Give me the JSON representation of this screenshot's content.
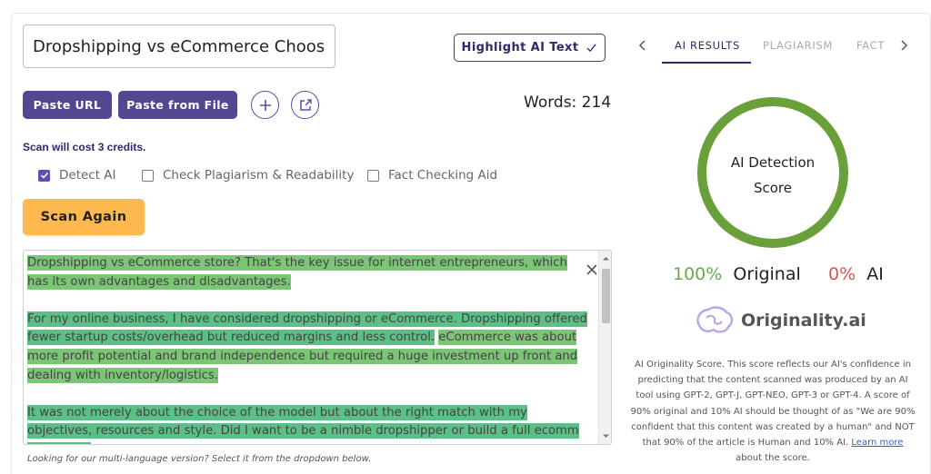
{
  "header": {
    "title_value": "Dropshipping vs eCommerce Choosing",
    "highlight_button": "Highlight AI Text"
  },
  "toolbar": {
    "paste_url": "Paste URL",
    "paste_file": "Paste from File",
    "words_label": "Words: 214"
  },
  "scan": {
    "cost_text": "Scan will cost 3 credits.",
    "options": [
      {
        "label": "Detect AI",
        "checked": true
      },
      {
        "label": "Check Plagiarism & Readability",
        "checked": false
      },
      {
        "label": "Fact Checking Aid",
        "checked": false
      }
    ],
    "scan_button": "Scan Again"
  },
  "editor": {
    "p1": "Dropshipping vs eCommerce store? That's the key issue for internet entrepreneurs, which has its own advantages and disadvantages.",
    "p2a": "For my online business, I have considered dropshipping or eCommerce. Dropshipping offered fewer startup costs/overhead but reduced margins and less control.",
    "p2b": "eCommerce was about more profit potential and brand independence but required a huge investment up front and dealing with inventory/logistics.",
    "p3a": "It was not merely about the choice of the model but about the right match with my objectives, resources and style. Did I want to be a nimble dropshipper or build a full ecomm operation?"
  },
  "footer_note": "Looking for our multi-language version? Select it from the dropdown below.",
  "results": {
    "tabs": [
      "AI RESULTS",
      "PLAGIARISM",
      "FACT"
    ],
    "active_tab": 0,
    "gauge_line1": "AI Detection",
    "gauge_line2": "Score",
    "original_pct": "100%",
    "original_label": "Original",
    "ai_pct": "0%",
    "ai_label": "AI",
    "logo_text": "Originality.ai",
    "description": "AI Originality Score. This score reflects our AI's confidence in predicting that the content scanned was produced by an AI tool using GPT-2, GPT-J, GPT-NEO, GPT-3 or GPT-4. A score of 90% original and 10% AI should be thought of as \"We are 90% confident that this content was created by a human\" and NOT that 90% of the article is Human and 10% AI.",
    "learn_more": "Learn more",
    "desc_tail": "about the score.",
    "original_fraction": 1.0
  },
  "colors": {
    "brand_purple": "#524791",
    "scan_orange": "#fdb94e",
    "gauge_green": "#6aa03a",
    "highlight_green": "#7cc576",
    "ai_red": "#d9534f"
  }
}
